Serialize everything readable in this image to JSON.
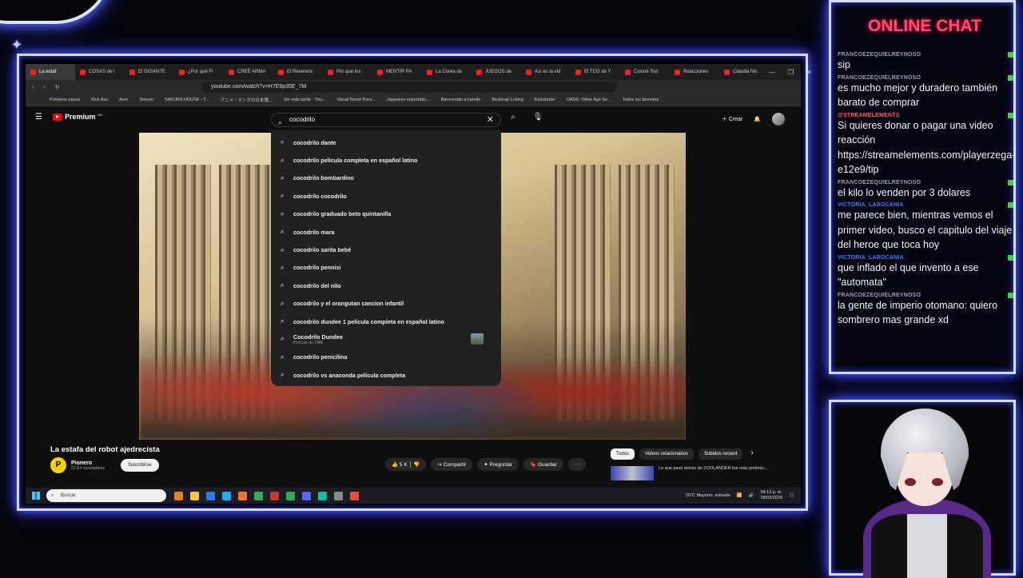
{
  "tabs": [
    "La estaf",
    "COSAS de l",
    "El GIGANTE",
    "¿Por qué FI",
    "CREÉ ARMA",
    "El Reverenc",
    "Por qué los",
    "MENTIR PA",
    "La Corea de",
    "JUEGOS de",
    "Así es la vid",
    "El TCG de Y",
    "Cociné Tod",
    "Reacciones",
    "Claudia Nic"
  ],
  "url": "youtube.com/watch?v=H7E9p35E_7M",
  "bookmarks": [
    "Primeros pasos",
    "Kick Ass",
    "Acer",
    "Stream",
    "SAKURA HOUSE - T...",
    "アニメ・マンガの日本語...",
    "Ver más tarde - You...",
    "Visual Novel Para...",
    "Japanese importatio...",
    "Bienvenido a kamite",
    "Beatmap Listing",
    "Kickstarter",
    "OASE: Other Age Se...",
    "Todos los favoritos"
  ],
  "yt": {
    "premium": "Premium",
    "region": "MX",
    "search_value": "cocodrilo",
    "create": "Crear"
  },
  "suggestions": [
    {
      "text": "cocodrilo dante"
    },
    {
      "text": "cocodrilo pelicula completa en español latino"
    },
    {
      "text": "cocodrilo bombardino"
    },
    {
      "text": "cocodrilo cocodrilo"
    },
    {
      "text": "cocodrilo graduado beto quintanilla"
    },
    {
      "text": "cocodrilo mara"
    },
    {
      "text": "cocodrilo sarita bebé"
    },
    {
      "text": "cocodrilo pennisi"
    },
    {
      "text": "cocodrilo del nilo"
    },
    {
      "text": "cocodrilo y el orangutan cancion infantil"
    },
    {
      "text": "cocodrilo dundee 1 pelicula completa en español latino"
    },
    {
      "text": "Cocodrilo Dundee",
      "sub": "Película de 1986"
    },
    {
      "text": "cocodrilo penicilina"
    },
    {
      "text": "cocodrilo vs anaconda pelicula completa"
    }
  ],
  "video": {
    "title": "La estafa del robot ajedrecista",
    "channel": "Pionero",
    "channel_initial": "P",
    "subs": "22.8 k suscriptores",
    "subscribe": "Suscribirse",
    "likes": "5 K",
    "share": "Compartir",
    "ask": "Preguntar",
    "save": "Guardar",
    "more": "···"
  },
  "chips": [
    "Todos",
    "Videos relacionados",
    "Subidos recient"
  ],
  "suggested_title": "Lo que pasó detrás de ZOOLANDER fue más polémic...",
  "taskbar": {
    "search": "Buscar",
    "weather": "20°C  Mayorm. soleado",
    "time": "04:13 p. m.",
    "date": "28/03/2026"
  },
  "chat": {
    "title": "ONLINE CHAT",
    "messages": [
      {
        "user": "FRANCOEZEQUIELREYNOSO",
        "text": "sip",
        "kind": "normal"
      },
      {
        "user": "FRANCOEZEQUIELREYNOSO",
        "text": "es mucho mejor y duradero también barato de comprar",
        "kind": "normal"
      },
      {
        "user": "@STREAMELEMENTS",
        "text": "Si quieres donar o pagar una video reacción https://streamelements.com/playerzega-e12e9/tip",
        "kind": "se"
      },
      {
        "user": "FRANCOEZEQUIELREYNOSO",
        "text": "el kilo lo venden por 3 dolares",
        "kind": "normal"
      },
      {
        "user": "VICTORIA_LABOCANIA",
        "text": "me parece bien, mientras vemos el primer video, busco el capitulo del viaje del heroe que toca hoy",
        "kind": "vic"
      },
      {
        "user": "VICTORIA_LABOCANIA",
        "text": "que inflado el que invento a ese \"automata\"",
        "kind": "vic"
      },
      {
        "user": "FRANCOEZEQUIELREYNOSO",
        "text": "la gente de imperio otomano: quiero sombrero mas grande xd",
        "kind": "normal"
      }
    ]
  },
  "colors": {
    "accent_frame": "#d6dcff",
    "chat_title": "#ff4a6a",
    "yt_red": "#ff0000"
  }
}
